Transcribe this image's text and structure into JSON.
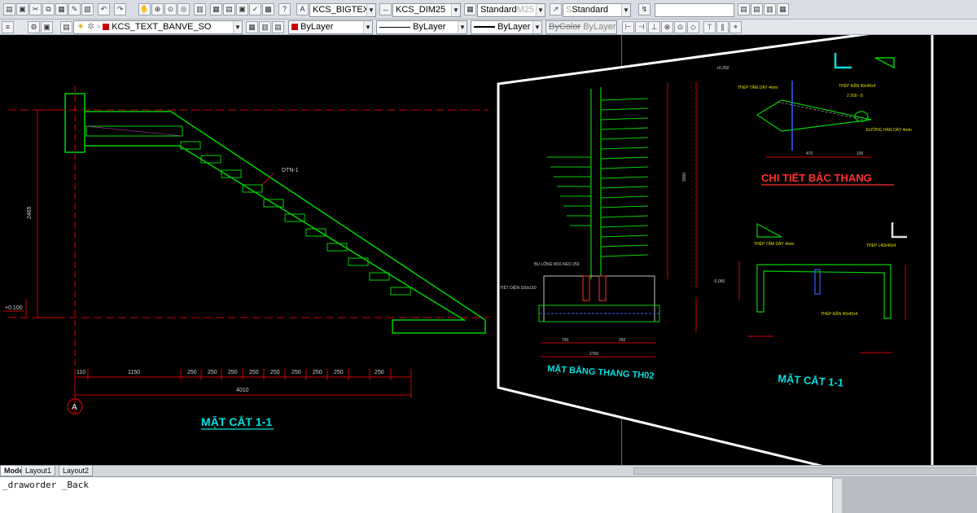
{
  "toolbar_top": {
    "text_style": "KCS_BIGTEX",
    "dim_style": "KCS_DIM25",
    "table_style": "Standard",
    "table_style_ghost": "M25",
    "multileader_style": "Standard",
    "multileader_prefix": "S"
  },
  "toolbar_layers": {
    "layer_name": "KCS_TEXT_BANVE_SO",
    "color": "ByLayer",
    "color_swatch": "#cc0000",
    "linetype": "ByLayer",
    "lineweight": "ByLayer",
    "plotstyle": "ByColor",
    "plotstyle2": "ByLayer"
  },
  "drawing_left": {
    "title": "MẶT CẮT 1-1",
    "elevation_label": "+0.100",
    "height_dim": "2465",
    "beam_label": "DTN-1",
    "grid_bubble": "A",
    "dims": [
      "110",
      "1150",
      "250",
      "250",
      "250",
      "250",
      "250",
      "250",
      "250",
      "250",
      "250"
    ],
    "total_dim": "4010"
  },
  "drawing_right": {
    "plan_title": "MẶT BẰNG THANG TH02",
    "detail_title": "CHI TIẾT BẬC THANG",
    "section_title": "MẶT CẮT 1-1",
    "detail_label_1": "THÉP TẤM DÀY 4mm",
    "detail_label_2": "THÉP ĐẶN 40x40x4",
    "detail_label_3": "2 200 - 8",
    "detail_label_4": "ĐƯỜNG HÀN DÀY 4mm",
    "detail_dim_a": "470",
    "detail_dim_b": "100",
    "detail_elev": "+0.250",
    "section_label_1": "THÉP TẤM DÀY 4mm",
    "section_label_2": "THÉP L40x40x4",
    "section_label_3": "THÉP ĐẶN 40x40x4",
    "section_elev": "-0.050",
    "plan_label_1": "BU LÔNG M16 NEO 250",
    "plan_label_2": "TIẾT DIỆN 150x150",
    "plan_dim_a": "750",
    "plan_dim_b": "250",
    "plan_dim_total": "2700",
    "plan_side_dim": "3000"
  },
  "layout_tabs": [
    "Model",
    "Layout1",
    "Layout2"
  ],
  "command_line": "_draworder _Back"
}
